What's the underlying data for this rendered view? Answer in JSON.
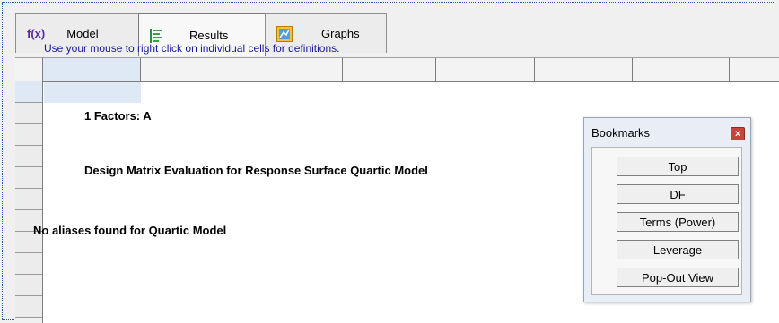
{
  "tabs": [
    {
      "icon": "fx-icon",
      "icon_text": "f(x)",
      "label": "Model"
    },
    {
      "icon": "results-table-icon",
      "label": "Results"
    },
    {
      "icon": "graphs-icon",
      "label": "Graphs"
    }
  ],
  "active_tab": "Results",
  "content": {
    "hint": "Use your mouse to right click on individual cells for definitions.",
    "factors": "1 Factors: A",
    "design_title": "Design Matrix Evaluation for Response Surface Quartic Model",
    "aliases": "No aliases found for Quartic Model"
  },
  "bookmarks": {
    "title": "Bookmarks",
    "close_glyph": "x",
    "items": [
      "Top",
      "DF",
      "Terms (Power)",
      "Leverage",
      "Pop-Out View"
    ]
  },
  "colors": {
    "hint_text": "#1a1aa0",
    "fx_icon": "#5a2ca0",
    "selection": "#dfe9f5",
    "close_button": "#c8443a"
  }
}
